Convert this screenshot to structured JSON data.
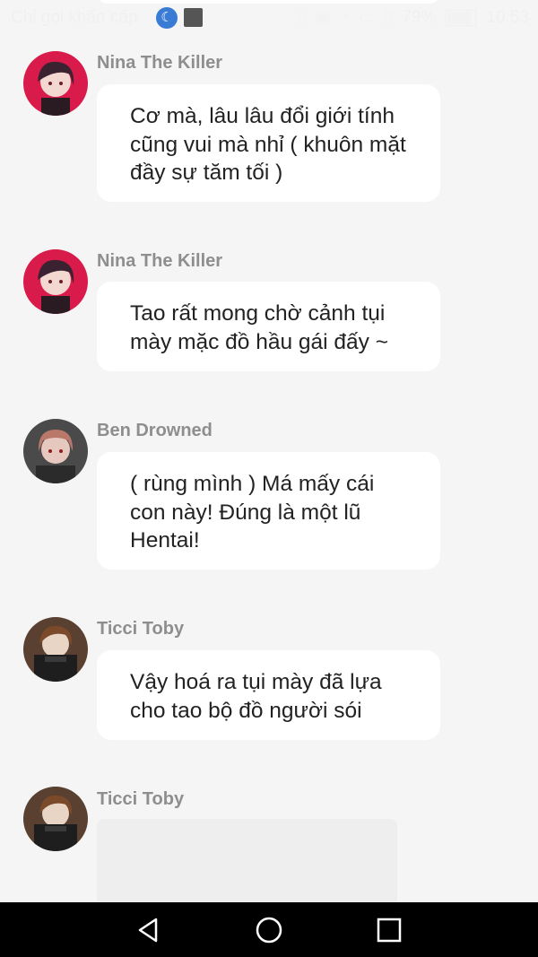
{
  "status_bar": {
    "carrier": "Chỉ gọi khẩn cấp",
    "battery": "79%",
    "battery_level": 0.79,
    "time": "10:53",
    "icons": [
      "moon-icon",
      "gallery-icon",
      "vibrate-icon",
      "eye-icon",
      "wifi-icon",
      "sim-icon",
      "sim2-icon",
      "battery-icon"
    ]
  },
  "messages": [
    {
      "sender": "Nina The Killer",
      "avatar": "avatar-nina",
      "text": "Cơ mà, lâu lâu đổi giới tính cũng vui mà nhỉ ( khuôn mặt đầy sự tăm tối )"
    },
    {
      "sender": "Nina The Killer",
      "avatar": "avatar-nina",
      "text": "Tao rất mong chờ cảnh tụi mày mặc đồ hầu gái đấy ~"
    },
    {
      "sender": "Ben Drowned",
      "avatar": "avatar-ben",
      "text": "( rùng mình ) Má mấy cái con này! Đúng là một lũ Hentai!"
    },
    {
      "sender": "Ticci Toby",
      "avatar": "avatar-toby",
      "text": "Vậy hoá ra tụi mày đã lựa cho tao bộ đồ người sói"
    },
    {
      "sender": "Ticci Toby",
      "avatar": "avatar-toby",
      "text": ""
    }
  ],
  "nav_bar": {
    "icons": [
      "back-icon",
      "home-icon",
      "recents-icon"
    ]
  },
  "colors": {
    "background": "#f5f5f5",
    "bubble": "#ffffff",
    "sender_name": "#8e8e8e",
    "nav_bar": "#000000",
    "nina_avatar_bg": "#d81b4a"
  }
}
